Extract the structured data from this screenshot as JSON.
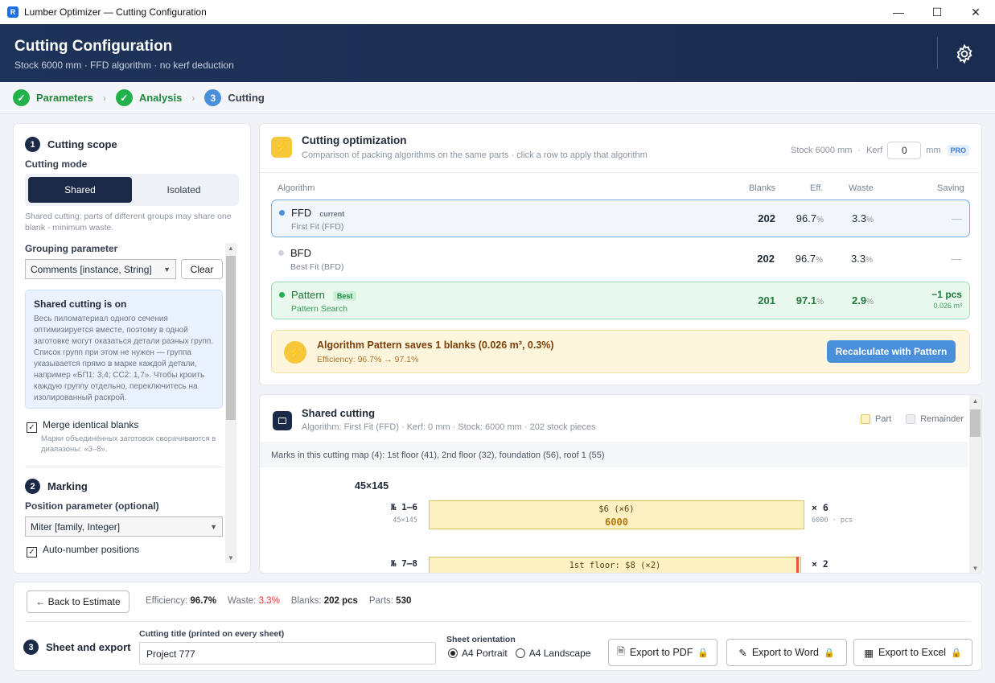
{
  "window": {
    "app_icon": "R",
    "title": "Lumber Optimizer — Cutting Configuration",
    "minimize": "—",
    "maximize": "☐",
    "close": "✕"
  },
  "header": {
    "title": "Cutting Configuration",
    "subtitle": "Stock 6000 mm · FFD algorithm · no kerf deduction"
  },
  "steps": [
    {
      "label": "Parameters",
      "mark": "✓",
      "state": "done"
    },
    {
      "label": "Analysis",
      "mark": "✓",
      "state": "done"
    },
    {
      "label": "Cutting",
      "mark": "3",
      "state": "current"
    }
  ],
  "step_sep": "›",
  "left": {
    "scope_num": "1",
    "scope_title": "Cutting scope",
    "mode_label": "Cutting mode",
    "modes": [
      "Shared",
      "Isolated"
    ],
    "mode_hint": "Shared cutting: parts of different groups may share one blank - minimum waste.",
    "grouping_label": "Grouping parameter",
    "grouping_value": "Comments  [instance, String]",
    "clear_label": "Clear",
    "info_title": "Shared cutting is on",
    "info_text": "Весь пиломатериал одного сечения оптимизируется вместе, поэтому в одной заготовке могут оказаться детали разных групп. Список групп при этом не нужен — группа указывается прямо в марке каждой детали, например «БП1: 3,4; СС2: 1,7». Чтобы кроить каждую группу отдельно, переключитесь на изолированный раскрой.",
    "merge_label": "Merge identical blanks",
    "merge_hint": "Марки объединённых заготовок сворачиваются в диапазоны: «3–8».",
    "marking_num": "2",
    "marking_title": "Marking",
    "position_label": "Position parameter (optional)",
    "position_value": "Miter  [family, Integer]",
    "autonumber_label": "Auto-number positions",
    "check": "✓"
  },
  "optimization": {
    "title": "Cutting optimization",
    "subtitle": "Comparison of packing algorithms on the same parts  ·  click a row to apply that algorithm",
    "stock": "Stock 6000 mm",
    "dot": "·",
    "kerf_label": "Kerf",
    "kerf_value": "0",
    "kerf_unit": "mm",
    "pro": "PRO",
    "columns": [
      "Algorithm",
      "Blanks",
      "Eff.",
      "Waste",
      "Saving"
    ],
    "rows": [
      {
        "name": "FFD",
        "tag": "current",
        "sub": "First Fit (FFD)",
        "blanks": "202",
        "eff": "96.7",
        "waste": "3.3",
        "saving": "—",
        "saving_sub": ""
      },
      {
        "name": "BFD",
        "tag": "",
        "sub": "Best Fit (BFD)",
        "blanks": "202",
        "eff": "96.7",
        "waste": "3.3",
        "saving": "—",
        "saving_sub": ""
      },
      {
        "name": "Pattern",
        "tag": "Best",
        "sub": "Pattern Search",
        "blanks": "201",
        "eff": "97.1",
        "waste": "2.9",
        "saving": "−1 pcs",
        "saving_sub": "0.026 m³"
      }
    ],
    "pct": "%",
    "banner_title": "Algorithm Pattern saves 1 blanks (0.026 m³, 0.3%)",
    "banner_sub": "Efficiency: 96.7% → 97.1%",
    "recalc_label": "Recalculate with Pattern",
    "bolt": "⚡"
  },
  "shared": {
    "title": "Shared cutting",
    "subtitle": "Algorithm: First Fit (FFD)  ·  Kerf: 0 mm  ·  Stock: 6000 mm  ·  202 stock pieces",
    "legend_part": "Part",
    "legend_remainder": "Remainder",
    "marks_line": "Marks in this cutting map (4):  1st floor (41),  2nd floor (32),  foundation (56),  roof 1 (55)",
    "section": "45×145",
    "bars": [
      {
        "label": "№ 1–6",
        "sublabel": "45×145",
        "text": "$6 (×6)",
        "length": "6000",
        "count": "× 6",
        "count_sub": "6000 · pcs"
      },
      {
        "label": "№ 7–8",
        "sublabel": "",
        "text": "1st floor: $8 (×2)",
        "length": "",
        "count": "× 2",
        "count_sub": ""
      }
    ],
    "scroll_up": "▲",
    "scroll_down": "▼"
  },
  "footer": {
    "back_label": "← Back to Estimate",
    "stats": [
      {
        "label": "Efficiency:",
        "value": "96.7%"
      },
      {
        "label": "Waste:",
        "value": "3.3%"
      },
      {
        "label": "Blanks:",
        "value": "202 pcs"
      },
      {
        "label": "Parts:",
        "value": "530"
      }
    ],
    "export_num": "3",
    "export_title": "Sheet and export",
    "cutting_title_label": "Cutting title (printed on every sheet)",
    "cutting_title_value": "Project 777",
    "orientation_label": "Sheet orientation",
    "orientations": [
      "A4 Portrait",
      "A4 Landscape"
    ],
    "export_pdf": "Export to PDF",
    "export_word": "Export to Word",
    "export_excel": "Export to Excel"
  },
  "colors": {
    "accent": "#4a8fdc",
    "success": "#22b14c",
    "warning": "#f7c73b",
    "danger": "#e53935",
    "navy": "#1a2a47"
  }
}
